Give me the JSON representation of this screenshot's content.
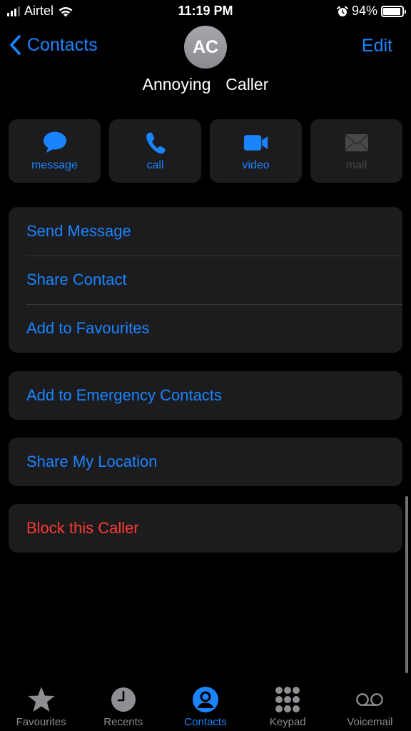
{
  "status_bar": {
    "carrier": "Airtel",
    "time": "11:19 PM",
    "battery_percent_label": "94%",
    "battery_level": 0.94,
    "signal_bars": 3,
    "icons": [
      "signal-icon",
      "wifi-icon",
      "alarm-icon",
      "battery-icon"
    ]
  },
  "nav": {
    "back_label": "Contacts",
    "edit_label": "Edit"
  },
  "contact": {
    "initials": "AC",
    "name": "Annoying  Caller"
  },
  "actions": [
    {
      "label": "message",
      "icon": "message-bubble-icon",
      "enabled": true
    },
    {
      "label": "call",
      "icon": "phone-icon",
      "enabled": true
    },
    {
      "label": "video",
      "icon": "video-camera-icon",
      "enabled": true
    },
    {
      "label": "mail",
      "icon": "envelope-icon",
      "enabled": false
    }
  ],
  "list_groups": [
    {
      "items": [
        "Send Message",
        "Share Contact",
        "Add to Favourites"
      ]
    },
    {
      "items": [
        "Add to Emergency Contacts"
      ]
    },
    {
      "items": [
        "Share My Location"
      ]
    },
    {
      "items": [
        "Block this Caller"
      ]
    }
  ],
  "tab_bar": {
    "tabs": [
      {
        "label": "Favourites",
        "icon": "star-icon",
        "active": false
      },
      {
        "label": "Recents",
        "icon": "clock-icon",
        "active": false
      },
      {
        "label": "Contacts",
        "icon": "person-circle-icon",
        "active": true
      },
      {
        "label": "Keypad",
        "icon": "keypad-icon",
        "active": false
      },
      {
        "label": "Voicemail",
        "icon": "voicemail-icon",
        "active": false
      }
    ]
  },
  "colors": {
    "accent": "#1a84ff",
    "destructive": "#ff3b30",
    "background": "#000000",
    "card": "#1c1c1e",
    "inactive": "#8e8e93",
    "disabled": "#48484a"
  }
}
